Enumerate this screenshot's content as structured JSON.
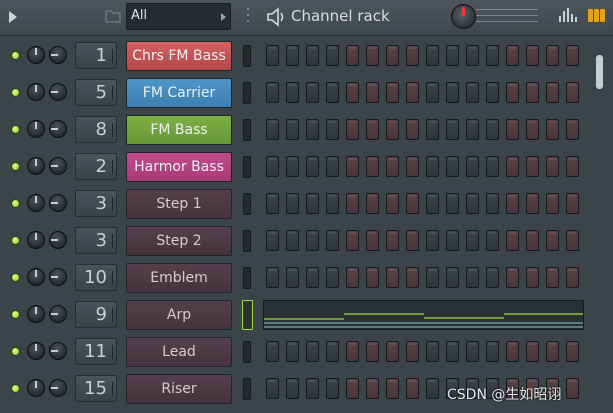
{
  "titlebar": {
    "filter_value": "All",
    "title": "Channel rack"
  },
  "colors": {
    "led_on": "#8fd633",
    "step_gray": "#3c4448",
    "step_red": "#5a4347",
    "accent_orange": "#e3a21a",
    "knob_marker": "#e23c3c"
  },
  "icons": [
    "play-arrow-icon",
    "folder-icon",
    "dropdown-arrow-icon",
    "speaker-icon",
    "swing-knob-icon",
    "graph-editor-icon",
    "pattern-icon"
  ],
  "channels": [
    {
      "num": "1",
      "name": "Chrs FM Bass",
      "color": "red"
    },
    {
      "num": "5",
      "name": "FM Carrier",
      "color": "blue"
    },
    {
      "num": "8",
      "name": "FM Bass",
      "color": "green"
    },
    {
      "num": "2",
      "name": "Harmor Bass",
      "color": "pink"
    },
    {
      "num": "3",
      "name": "Step 1",
      "color": "plain"
    },
    {
      "num": "3",
      "name": "Step 2",
      "color": "plain"
    },
    {
      "num": "10",
      "name": "Emblem",
      "color": "plain"
    },
    {
      "num": "9",
      "name": "Arp",
      "color": "plain",
      "piano_roll": true
    },
    {
      "num": "11",
      "name": "Lead",
      "color": "plain"
    },
    {
      "num": "15",
      "name": "Riser",
      "color": "plain"
    }
  ],
  "watermark": "CSDN @生如昭诩"
}
